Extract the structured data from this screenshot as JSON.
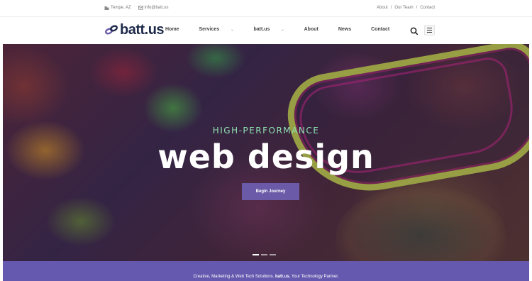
{
  "topbar": {
    "location": "Tempe, AZ",
    "location_icon": "building-icon",
    "email": "info@batt.us",
    "email_icon": "email-icon",
    "links": [
      "About",
      "Our Team",
      "Contact"
    ],
    "separator": "/"
  },
  "brand": {
    "name": "batt.us",
    "logo_icon": "link-icon",
    "color": "#1e2a4a"
  },
  "nav": {
    "items": [
      {
        "label": "Home",
        "has_dropdown": false
      },
      {
        "label": "Services",
        "has_dropdown": true
      },
      {
        "label": "batt.us",
        "has_dropdown": true
      },
      {
        "label": "About",
        "has_dropdown": false
      },
      {
        "label": "News",
        "has_dropdown": false
      },
      {
        "label": "Contact",
        "has_dropdown": false
      }
    ],
    "caret": "⌄",
    "search_icon": "search-icon",
    "menu_icon": "hamburger-menu-icon"
  },
  "hero": {
    "subtitle": "HIGH-PERFORMANCE",
    "title": "web design",
    "cta_label": "Begin Journey",
    "accent": "#6a5aa8",
    "subtitle_color": "#8ee0b0",
    "slide_count": 3,
    "active_slide": 1
  },
  "band": {
    "text_before": "Creative, Marketing & Web Tech Solutions. ",
    "brand": "batt.us",
    "text_after": ", Your Technology Partner.",
    "color": "#6459ae"
  }
}
